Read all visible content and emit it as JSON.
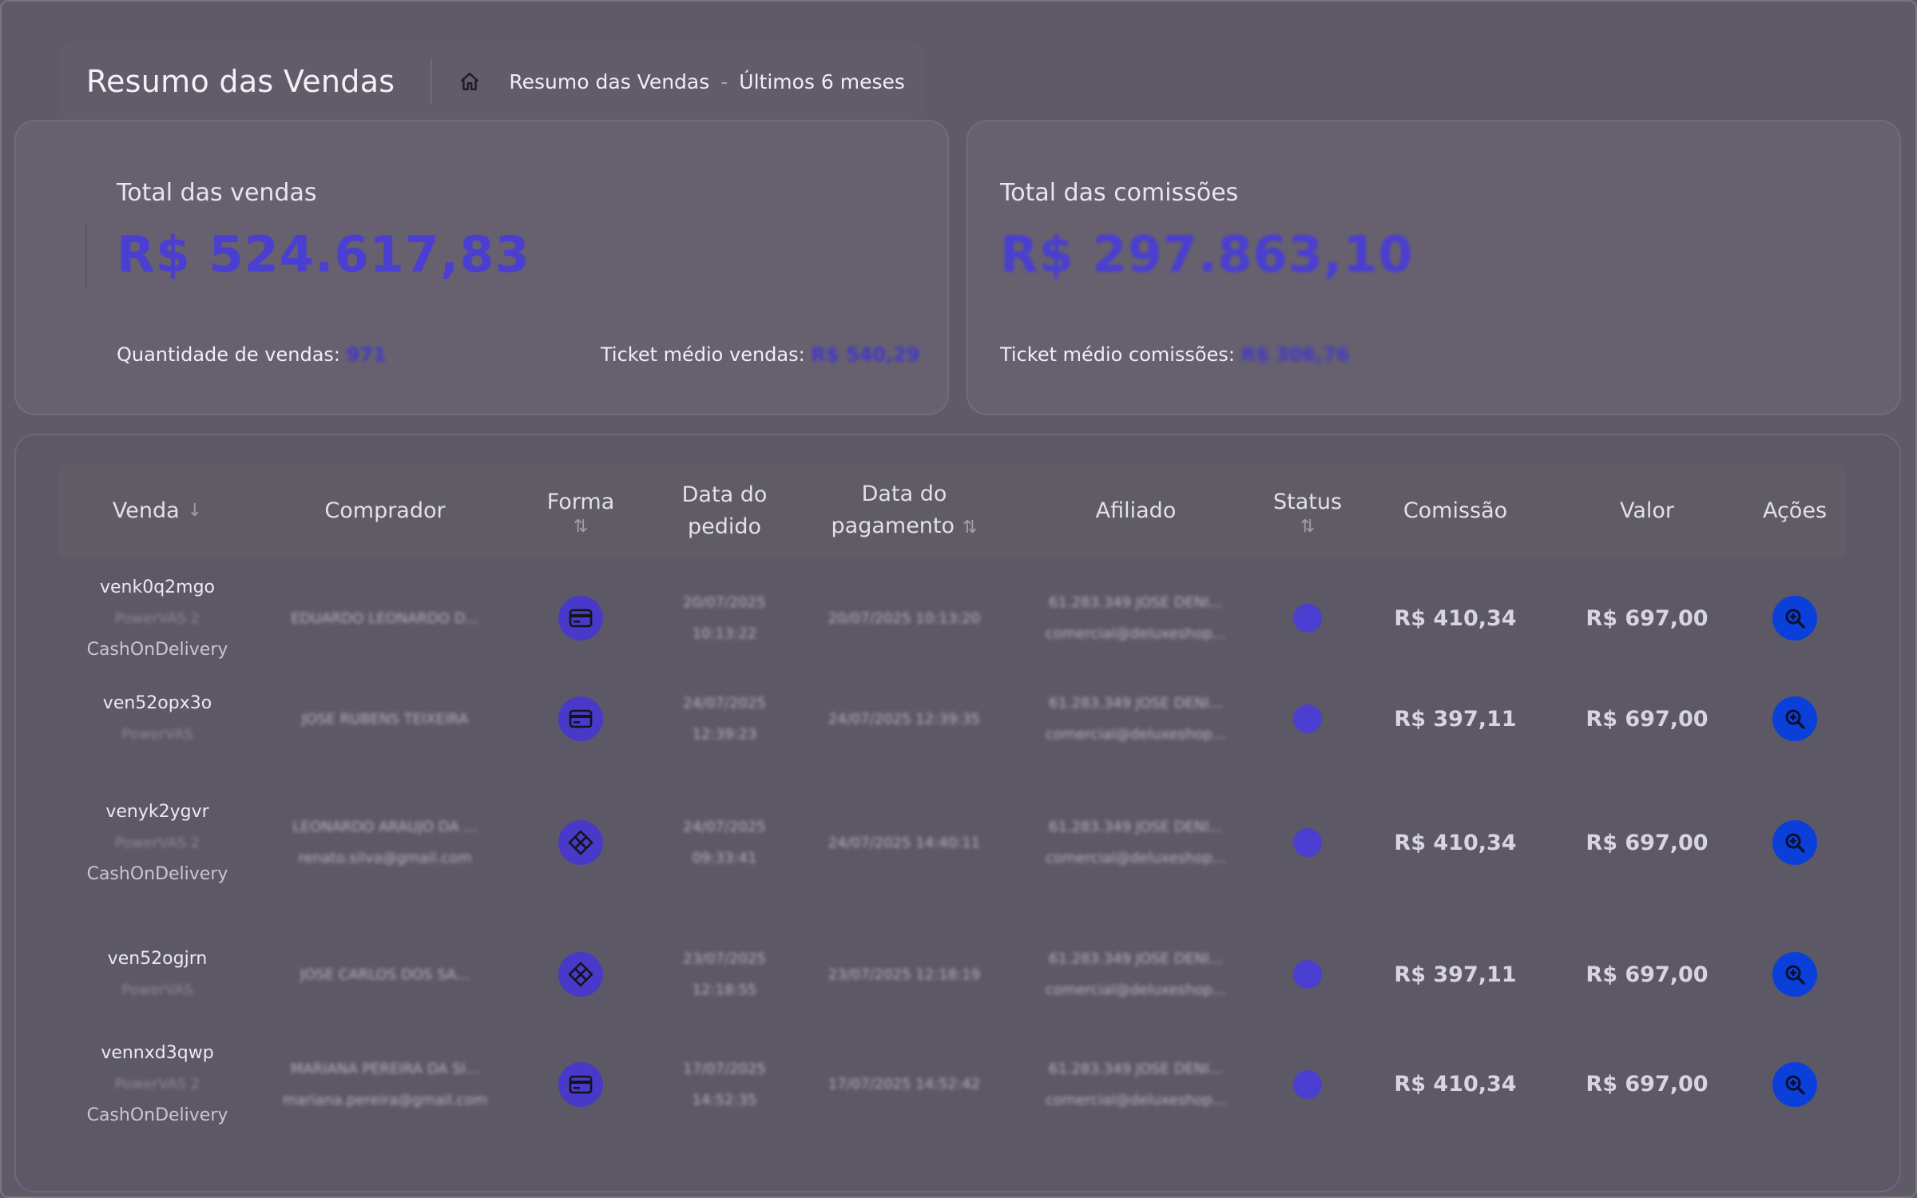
{
  "header": {
    "title": "Resumo das Vendas",
    "breadcrumb": [
      "Resumo das Vendas",
      "Últimos 6 meses"
    ],
    "separator": "-"
  },
  "sales_card": {
    "label": "Total das vendas",
    "value": "R$ 524.617,83",
    "qty_label": "Quantidade de vendas:",
    "qty_value": "971",
    "ticket_label": "Ticket médio vendas:",
    "ticket_value": "R$ 540,29"
  },
  "commission_card": {
    "label": "Total das comissões",
    "value": "R$ 297.863,10",
    "ticket_label": "Ticket médio comissões:",
    "ticket_value": "R$ 306,76"
  },
  "table": {
    "columns": {
      "venda": "Venda",
      "comprador": "Comprador",
      "forma": "Forma",
      "data_pedido_1": "Data do",
      "data_pedido_2": "pedido",
      "data_pag_1": "Data do",
      "data_pag_2": "pagamento",
      "afiliado": "Afiliado",
      "status": "Status",
      "comissao": "Comissão",
      "valor": "Valor",
      "acoes": "Ações"
    },
    "rows": [
      {
        "id": "venk0q2mgo",
        "sub": "PowerVAS 2",
        "cod": "CashOnDelivery",
        "buyer": [
          "EDUARDO LEONARDO D..."
        ],
        "pay": "card",
        "order_date": [
          "20/07/2025",
          "10:13:22"
        ],
        "pay_date": "20/07/2025 10:13:20",
        "affiliate": [
          "61.283.349 JOSE DENI...",
          "comercial@deluxeshop..."
        ],
        "commission": "R$ 410,34",
        "value": "R$ 697,00"
      },
      {
        "id": "ven52opx3o",
        "sub": "PowerVAS",
        "cod": "",
        "buyer": [
          "JOSE RUBENS TEIXEIRA"
        ],
        "pay": "card",
        "order_date": [
          "24/07/2025",
          "12:39:23"
        ],
        "pay_date": "24/07/2025 12:39:35",
        "affiliate": [
          "61.283.349 JOSE DENI...",
          "comercial@deluxeshop..."
        ],
        "commission": "R$ 397,11",
        "value": "R$ 697,00"
      },
      {
        "id": "venyk2ygvr",
        "sub": "PowerVAS 2",
        "cod": "CashOnDelivery",
        "buyer": [
          "LEONARDO ARAUJO DA ...",
          "renato.silva@gmail.com"
        ],
        "pay": "pix",
        "order_date": [
          "24/07/2025",
          "09:33:41"
        ],
        "pay_date": "24/07/2025 14:40:11",
        "affiliate": [
          "61.283.349 JOSE DENI...",
          "comercial@deluxeshop..."
        ],
        "commission": "R$ 410,34",
        "value": "R$ 697,00"
      },
      {
        "id": "ven52ogjrn",
        "sub": "PowerVAS",
        "cod": "",
        "buyer": [
          "JOSE CARLOS DOS SA..."
        ],
        "pay": "pix",
        "order_date": [
          "23/07/2025",
          "12:18:55"
        ],
        "pay_date": "23/07/2025 12:18:19",
        "affiliate": [
          "61.283.349 JOSE DENI...",
          "comercial@deluxeshop..."
        ],
        "commission": "R$ 397,11",
        "value": "R$ 697,00"
      },
      {
        "id": "vennxd3qwp",
        "sub": "PowerVAS 2",
        "cod": "CashOnDelivery",
        "buyer": [
          "MARIANA PEREIRA DA SI...",
          "mariana.pereira@gmail.com"
        ],
        "pay": "card",
        "order_date": [
          "17/07/2025",
          "14:52:35"
        ],
        "pay_date": "17/07/2025 14:52:42",
        "affiliate": [
          "61.283.349 JOSE DENI...",
          "comercial@deluxeshop..."
        ],
        "commission": "R$ 410,34",
        "value": "R$ 697,00"
      }
    ]
  },
  "colors": {
    "background": "#5f5a68",
    "accent": "#4a3fd0",
    "action": "#0b3fd9"
  },
  "icons": {
    "home": "home-icon",
    "card": "credit-card-icon",
    "pix": "pix-icon",
    "status": "status-dot",
    "action": "zoom-in-icon"
  }
}
